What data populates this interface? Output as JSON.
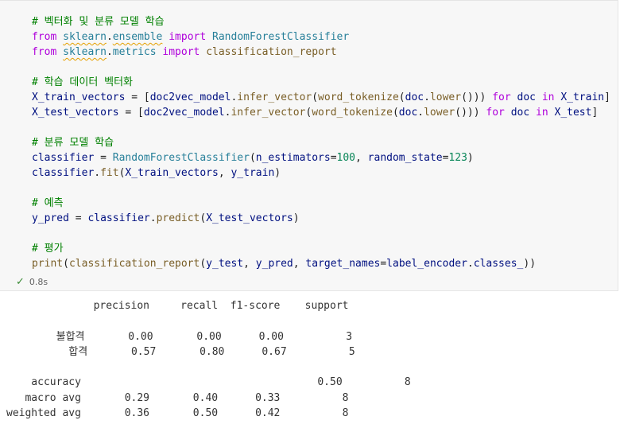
{
  "code_lines": [
    "# 벡터화 및 분류 모델 학습",
    "from sklearn.ensemble import RandomForestClassifier",
    "from sklearn.metrics import classification_report",
    "",
    "# 학습 데이터 벡터화",
    "X_train_vectors = [doc2vec_model.infer_vector(word_tokenize(doc.lower())) for doc in X_train]",
    "X_test_vectors = [doc2vec_model.infer_vector(word_tokenize(doc.lower())) for doc in X_test]",
    "",
    "# 분류 모델 학습",
    "classifier = RandomForestClassifier(n_estimators=100, random_state=123)",
    "classifier.fit(X_train_vectors, y_train)",
    "",
    "# 예측",
    "y_pred = classifier.predict(X_test_vectors)",
    "",
    "# 평가",
    "print(classification_report(y_test, y_pred, target_names=label_encoder.classes_))"
  ],
  "status": {
    "icon": "check-icon",
    "duration": "0.8s"
  },
  "report": {
    "headers": [
      "precision",
      "recall",
      "f1-score",
      "support"
    ],
    "rows": [
      {
        "label": "불합격",
        "precision": "0.00",
        "recall": "0.00",
        "f1": "0.00",
        "support": "3"
      },
      {
        "label": "합격",
        "precision": "0.57",
        "recall": "0.80",
        "f1": "0.67",
        "support": "5"
      }
    ],
    "accuracy": {
      "label": "accuracy",
      "f1": "0.50",
      "support": "8"
    },
    "macro_avg": {
      "label": "macro avg",
      "precision": "0.29",
      "recall": "0.40",
      "f1": "0.33",
      "support": "8"
    },
    "weighted_avg": {
      "label": "weighted avg",
      "precision": "0.36",
      "recall": "0.50",
      "f1": "0.42",
      "support": "8"
    }
  }
}
